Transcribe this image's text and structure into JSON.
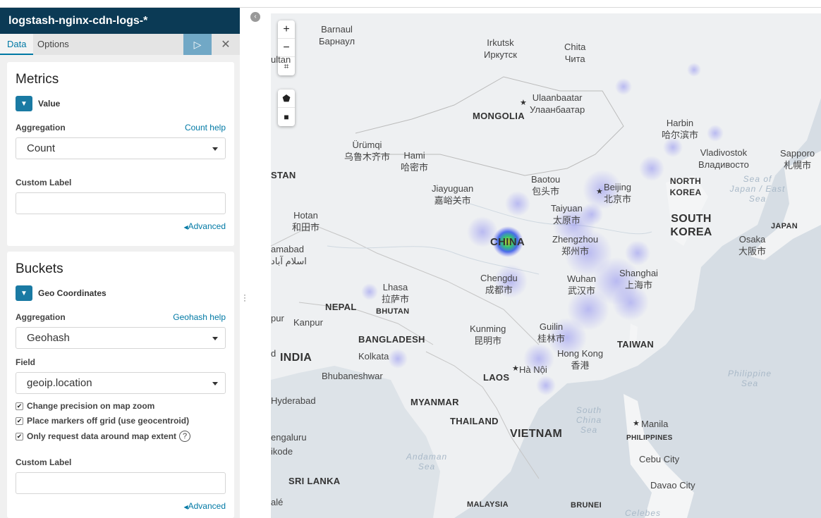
{
  "sidebar": {
    "index_pattern": "logstash-nginx-cdn-logs-*",
    "tabs": [
      "Data",
      "Options"
    ],
    "run_icon": "play-icon",
    "close_icon": "close-icon"
  },
  "metrics": {
    "title": "Metrics",
    "agg_name": "Value",
    "aggregation_label": "Aggregation",
    "help_link": "Count help",
    "aggregation_value": "Count",
    "custom_label": "Custom Label",
    "custom_label_value": "",
    "advanced": "Advanced"
  },
  "buckets": {
    "title": "Buckets",
    "agg_name": "Geo Coordinates",
    "aggregation_label": "Aggregation",
    "help_link": "Geohash help",
    "aggregation_value": "Geohash",
    "field_label": "Field",
    "field_value": "geoip.location",
    "checks": [
      "Change precision on map zoom",
      "Place markers off grid (use geocentroid)",
      "Only request data around map extent"
    ],
    "help_glyph": "?",
    "custom_label": "Custom Label",
    "custom_label_value": "",
    "advanced": "Advanced"
  },
  "map": {
    "controls": [
      "+",
      "−"
    ],
    "cities": [
      {
        "name": "Barnaul",
        "native": "Барнаул"
      },
      {
        "name": "Irkutsk",
        "native": "Иркутск"
      },
      {
        "name": "Chita",
        "native": "Чита"
      },
      {
        "name": "Ulaanbaatar",
        "native": "Улаанбаатар"
      },
      {
        "name": "Harbin",
        "native": "哈尔滨市"
      },
      {
        "name": "Vladivostok",
        "native": "Владивосто"
      },
      {
        "name": "Sapporo",
        "native": "札幌市"
      },
      {
        "name": "Ürümqi",
        "native": "乌鲁木齐市"
      },
      {
        "name": "Hami",
        "native": "哈密市"
      },
      {
        "name": "Baotou",
        "native": "包头市"
      },
      {
        "name": "Beijing",
        "native": "北京市"
      },
      {
        "name": "Jiayuguan",
        "native": "嘉峪关市"
      },
      {
        "name": "Taiyuan",
        "native": "太原市"
      },
      {
        "name": "Hotan",
        "native": "和田市"
      },
      {
        "name": "Zhengzhou",
        "native": "郑州市"
      },
      {
        "name": "Osaka",
        "native": "大阪市"
      },
      {
        "name": "Chengdu",
        "native": "成都市"
      },
      {
        "name": "Wuhan",
        "native": "武汉市"
      },
      {
        "name": "Shanghai",
        "native": "上海市"
      },
      {
        "name": "Lhasa",
        "native": "拉萨市"
      },
      {
        "name": "Kunming",
        "native": "昆明市"
      },
      {
        "name": "Guilin",
        "native": "桂林市"
      },
      {
        "name": "Hong Kong",
        "native": "香港"
      }
    ],
    "single_cities": [
      "Kanpur",
      "Kolkata",
      "Bhubaneshwar",
      "Hà Nội",
      "Hyderabad",
      "Manila",
      "Cebu City",
      "Davao City"
    ],
    "countries": [
      "MONGOLIA",
      "NORTH KOREA",
      "SOUTH KOREA",
      "JAPAN",
      "CHINA",
      "NEPAL",
      "BHUTAN",
      "BANGLADESH",
      "INDIA",
      "TAIWAN",
      "LAOS",
      "MYANMAR",
      "THAILAND",
      "VIETNAM",
      "PHILIPPINES",
      "SRI LANKA",
      "MALAYSIA",
      "BRUNEI"
    ],
    "edge_labels": [
      "ultan",
      "STAN",
      "amabad",
      "اسلام آباد",
      "pur",
      "d",
      "engaluru",
      "ikode",
      "alé"
    ],
    "seas": [
      "Sea of Japan / East Sea",
      "South China Sea",
      "Philippine Sea",
      "Andaman Sea",
      "Celebes"
    ]
  }
}
